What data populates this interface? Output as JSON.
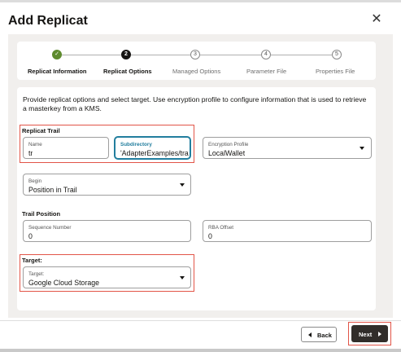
{
  "dialog": {
    "title": "Add Replicat",
    "close_glyph": "✕"
  },
  "steps": [
    {
      "label": "Replicat Information",
      "marker": "✓",
      "state": "done"
    },
    {
      "label": "Replicat Options",
      "marker": "2",
      "state": "current"
    },
    {
      "label": "Managed Options",
      "marker": "3",
      "state": "future"
    },
    {
      "label": "Parameter File",
      "marker": "4",
      "state": "future"
    },
    {
      "label": "Properties File",
      "marker": "5",
      "state": "future"
    }
  ],
  "description": "Provide replicat options and select target. Use encryption profile to configure information that is used to retrieve a masterkey from a KMS.",
  "replicat_trail": {
    "section_label": "Replicat Trail",
    "name": {
      "label": "Name",
      "value": "tr"
    },
    "subdirectory": {
      "label": "Subdirectory",
      "value": "'AdapterExamples/trail/"
    }
  },
  "encryption_profile": {
    "label": "Encryption Profile",
    "value": "LocalWallet"
  },
  "begin": {
    "label": "Begin",
    "value": "Position in Trail"
  },
  "trail_position": {
    "section_label": "Trail Position",
    "sequence_number": {
      "label": "Sequence Number",
      "value": "0"
    },
    "rba_offset": {
      "label": "RBA Offset",
      "value": "0"
    }
  },
  "target": {
    "section_label": "Target:",
    "field_label": "Target:",
    "value": "Google Cloud Storage"
  },
  "footer": {
    "back_label": "Back",
    "next_label": "Next"
  },
  "colors": {
    "accent": "#227e9e",
    "highlight": "#e25548",
    "done": "#5e8b2e",
    "primary_button": "#312d2a"
  },
  "icons": {
    "close": "close-icon",
    "back": "chevron-left-icon",
    "next": "chevron-right-icon",
    "dropdown": "caret-down-icon",
    "done": "check-icon"
  }
}
